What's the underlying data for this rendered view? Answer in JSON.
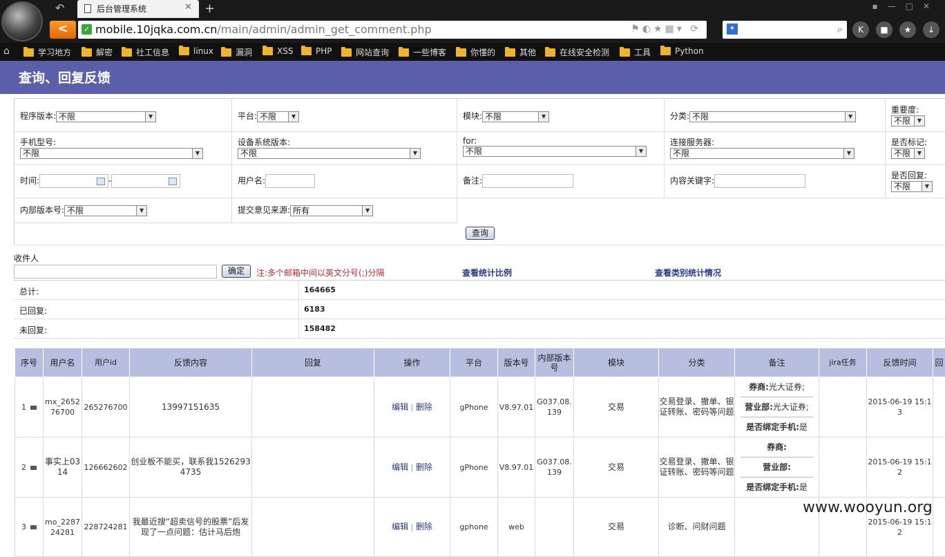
{
  "browser": {
    "tab_title": "后台管理系统",
    "url_domain": "mobile.10jqka.com.cn",
    "url_path": "/main/admin/admin_get_comment.php"
  },
  "bookmarks": [
    "学习地方",
    "解密",
    "社工信息",
    "linux",
    "漏洞",
    "XSS",
    "PHP",
    "网站查询",
    "一些博客",
    "你懂的",
    "其他",
    "在线安全检测",
    "工具",
    "Python"
  ],
  "page": {
    "title": "查询、回复反馈"
  },
  "filters": {
    "app_version": {
      "label": "程序版本:",
      "value": "不限"
    },
    "platform": {
      "label": "平台:",
      "value": "不限"
    },
    "module": {
      "label": "模块:",
      "value": "不限"
    },
    "category": {
      "label": "分类:",
      "value": "不限"
    },
    "importance": {
      "label": "重要度:",
      "value": "不限"
    },
    "phone_model": {
      "label": "手机型号:",
      "value": "不限"
    },
    "os_version": {
      "label": "设备系统版本:",
      "value": "不限"
    },
    "for": {
      "label": "for:",
      "value": "不限"
    },
    "server": {
      "label": "连接服务器:",
      "value": "不限"
    },
    "marked": {
      "label": "是否标记:",
      "value": "不限"
    },
    "time": {
      "label": "时间:",
      "dash": "-"
    },
    "username": {
      "label": "用户名:"
    },
    "remark": {
      "label": "备注:"
    },
    "keyword": {
      "label": "内容关键字:"
    },
    "replied": {
      "label": "是否回复:",
      "value": "不限"
    },
    "internal_version": {
      "label": "内部版本号:",
      "value": "不限"
    },
    "source": {
      "label": "提交意见来源:",
      "value": "所有"
    },
    "query_button": "查询"
  },
  "recipients": {
    "label": "收件人",
    "confirm_button": "确定",
    "note": "注:多个邮箱中间以英文分号(;)分隔",
    "stats_ratio_link": "查看统计比例",
    "category_stats_link": "查看类别统计情况"
  },
  "stats": [
    {
      "label": "总计:",
      "value": "164665"
    },
    {
      "label": "已回复:",
      "value": "6183"
    },
    {
      "label": "未回复:",
      "value": "158482"
    }
  ],
  "table": {
    "headers": [
      "序号",
      "用户名",
      "用户id",
      "反馈内容",
      "回复",
      "操作",
      "平台",
      "版本号",
      "内部版本号",
      "模块",
      "分类",
      "备注",
      "jira任务",
      "反馈时间",
      "回"
    ],
    "edit_label": "编辑",
    "delete_label": "删除",
    "op_sep": "|",
    "note_labels": {
      "broker": "券商:",
      "branch": "营业部:",
      "bound": "是否绑定手机:"
    },
    "rows": [
      {
        "idx": "1",
        "user": "mx_265276700",
        "uid": "265276700",
        "content": "13997151635",
        "reply": "",
        "platform": "gPhone",
        "version": "V8.97.01",
        "internal": "G037.08.139",
        "module": "交易",
        "category": "交易登录、撤单、银证转账、密码等问题",
        "broker": "光大证券;",
        "branch": "光大证券;",
        "bound": "是",
        "jira": "",
        "time": "2015-06-19 15:13"
      },
      {
        "idx": "2",
        "user": "事实上0314",
        "uid": "126662602",
        "content": "创业板不能买，联系我15262934735",
        "reply": "",
        "platform": "gPhone",
        "version": "V8.97.01",
        "internal": "G037.08.139",
        "module": "交易",
        "category": "交易登录、撤单、银证转账、密码等问题",
        "broker": "",
        "branch": "",
        "bound": "是",
        "jira": "",
        "time": "2015-06-19 15:12"
      },
      {
        "idx": "3",
        "user": "mo_228724281",
        "uid": "228724281",
        "content": "我最近搜“超卖信号的股票”后发现了一点问题：估计马后炮",
        "reply": "",
        "platform": "gphone",
        "version": "web",
        "internal": "",
        "module": "交易",
        "category": "诊断、问财问题",
        "broker": "",
        "branch": "",
        "bound": "",
        "jira": "",
        "time": "2015-06-19 15:12"
      }
    ]
  },
  "watermark": "www.wooyun.org"
}
